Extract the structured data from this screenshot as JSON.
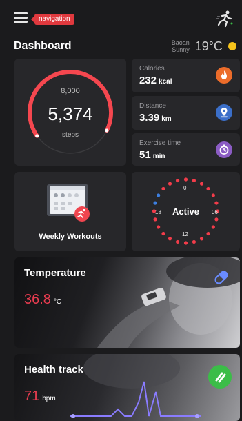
{
  "header": {
    "nav_badge": "navigation",
    "title": "Dashboard",
    "menu_icon": "hamburger-menu-icon",
    "runner_icon": "runner-icon"
  },
  "weather": {
    "location": "Baoan",
    "condition": "Sunny",
    "temperature": "19°C",
    "icon": "sun-icon"
  },
  "steps": {
    "goal": "8,000",
    "value": "5,374",
    "unit": "steps",
    "progress": 0.67,
    "color": "#f5474f"
  },
  "metrics": [
    {
      "label": "Calories",
      "value": "232",
      "unit": "kcal",
      "icon": "flame-icon",
      "color": "#ec6c2a"
    },
    {
      "label": "Distance",
      "value": "3.39",
      "unit": "km",
      "icon": "location-pin-icon",
      "color": "#3b6fc9"
    },
    {
      "label": "Exercise time",
      "value": "51",
      "unit": "min",
      "icon": "clock-icon",
      "color": "#8b5cc4"
    }
  ],
  "weekly": {
    "label": "Weekly Workouts",
    "icon": "calendar-workout-icon"
  },
  "active": {
    "label": "Active",
    "dial_labels": [
      "0",
      "06",
      "12",
      "18"
    ],
    "accent": "#3d7fe0",
    "dot_color": "#f23c4a"
  },
  "temperature_card": {
    "title": "Temperature",
    "value": "36.8",
    "unit": "°C",
    "icon": "pill-icon"
  },
  "health_card": {
    "title": "Health track",
    "value": "71",
    "unit": "bpm",
    "button_icon": "go-arrow-icon",
    "button_color": "#3bbd48"
  }
}
